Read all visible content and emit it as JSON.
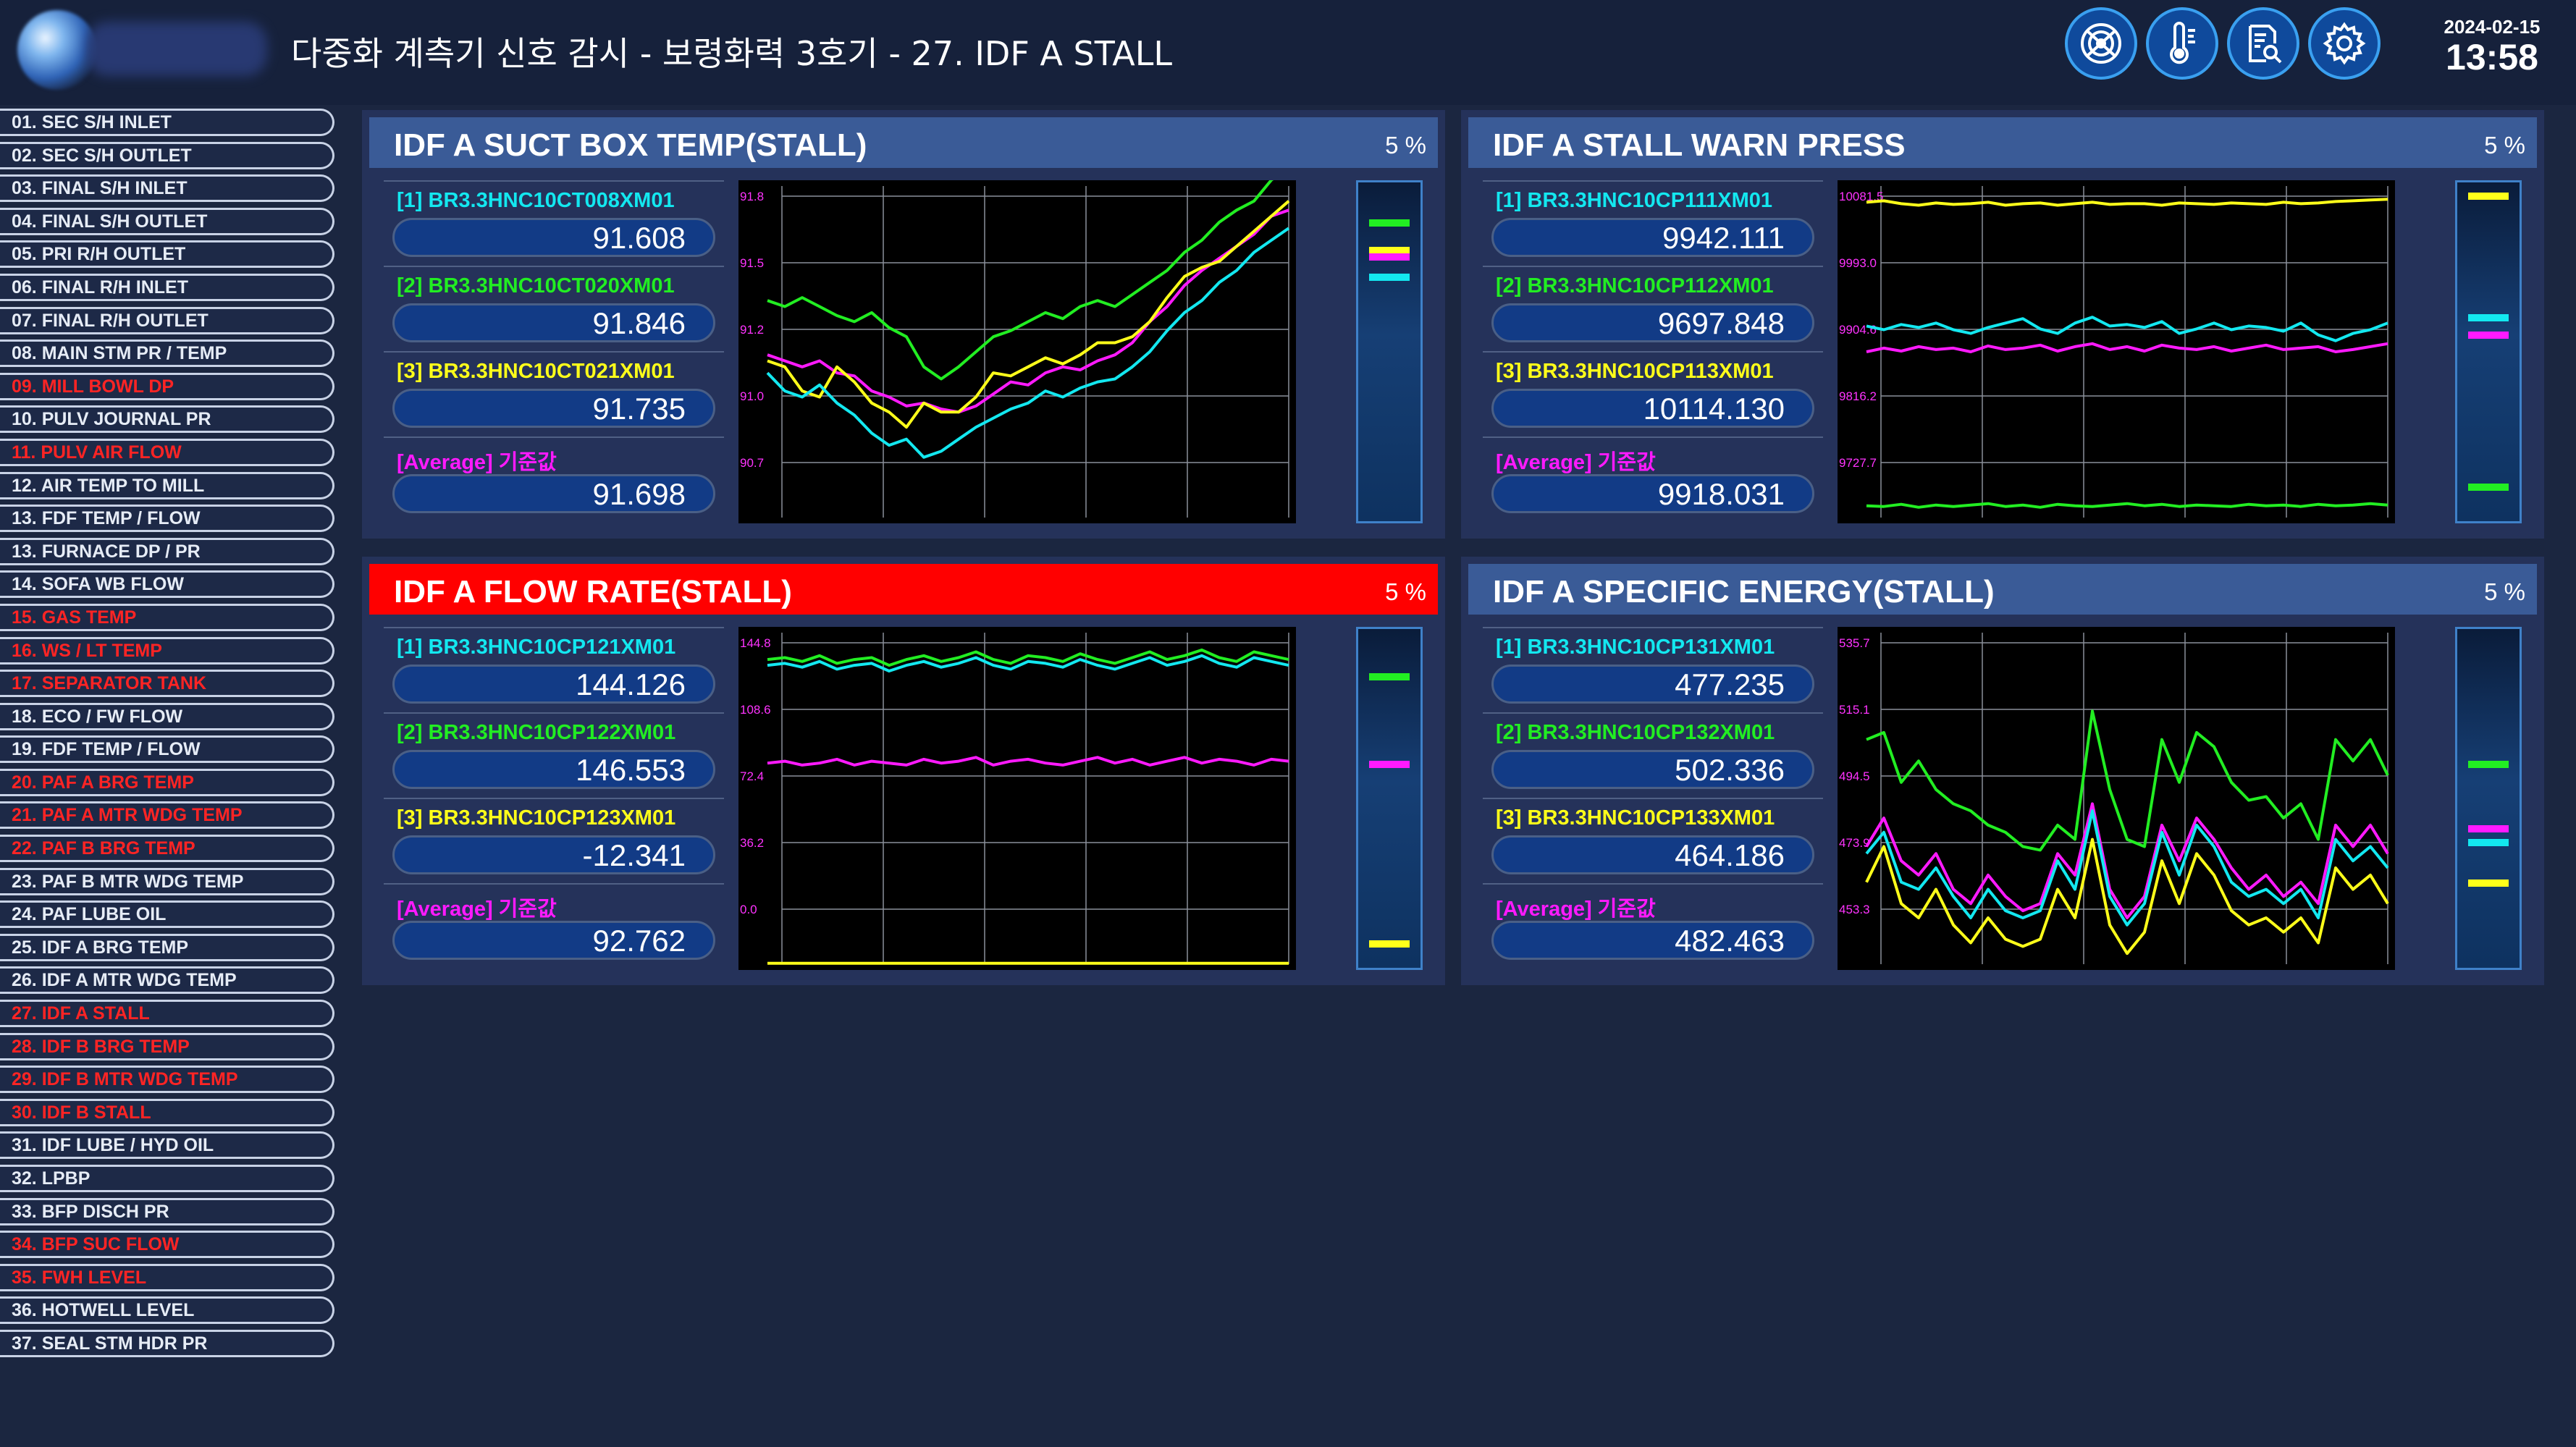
{
  "header": {
    "title": "다중화 계측기 신호 감시 - 보령화력 3호기 - 27. IDF A STALL",
    "date": "2024-02-15",
    "time": "13:58"
  },
  "toolbar_icons": [
    "radar-icon",
    "thermometer-icon",
    "report-search-icon",
    "gear-icon"
  ],
  "sidebar": {
    "items": [
      {
        "label": "01. SEC S/H INLET",
        "alert": false
      },
      {
        "label": "02. SEC S/H OUTLET",
        "alert": false
      },
      {
        "label": "03. FINAL S/H INLET",
        "alert": false
      },
      {
        "label": "04. FINAL S/H OUTLET",
        "alert": false
      },
      {
        "label": "05. PRI R/H OUTLET",
        "alert": false
      },
      {
        "label": "06. FINAL R/H INLET",
        "alert": false
      },
      {
        "label": "07. FINAL R/H OUTLET",
        "alert": false
      },
      {
        "label": "08. MAIN STM PR / TEMP",
        "alert": false
      },
      {
        "label": "09. MILL BOWL DP",
        "alert": true
      },
      {
        "label": "10. PULV JOURNAL PR",
        "alert": false
      },
      {
        "label": "11. PULV AIR FLOW",
        "alert": true
      },
      {
        "label": "12. AIR TEMP TO MILL",
        "alert": false
      },
      {
        "label": "13. FDF TEMP / FLOW",
        "alert": false
      },
      {
        "label": "13. FURNACE DP / PR",
        "alert": false
      },
      {
        "label": "14. SOFA WB FLOW",
        "alert": false
      },
      {
        "label": "15. GAS TEMP",
        "alert": true
      },
      {
        "label": "16. WS / LT TEMP",
        "alert": true
      },
      {
        "label": "17. SEPARATOR TANK",
        "alert": true
      },
      {
        "label": "18. ECO / FW FLOW",
        "alert": false
      },
      {
        "label": "19. FDF TEMP / FLOW",
        "alert": false
      },
      {
        "label": "20. PAF A BRG TEMP",
        "alert": true
      },
      {
        "label": "21. PAF A MTR WDG TEMP",
        "alert": true
      },
      {
        "label": "22. PAF B BRG TEMP",
        "alert": true
      },
      {
        "label": "23. PAF B MTR WDG TEMP",
        "alert": false
      },
      {
        "label": "24. PAF LUBE OIL",
        "alert": false
      },
      {
        "label": "25. IDF A BRG TEMP",
        "alert": false
      },
      {
        "label": "26. IDF A MTR WDG TEMP",
        "alert": false
      },
      {
        "label": "27. IDF A STALL",
        "alert": true
      },
      {
        "label": "28. IDF B BRG TEMP",
        "alert": true
      },
      {
        "label": "29. IDF B MTR WDG TEMP",
        "alert": true
      },
      {
        "label": "30. IDF B STALL",
        "alert": true
      },
      {
        "label": "31. IDF LUBE / HYD OIL",
        "alert": false
      },
      {
        "label": "32. LPBP",
        "alert": false
      },
      {
        "label": "33. BFP DISCH PR",
        "alert": false
      },
      {
        "label": "34. BFP SUC FLOW",
        "alert": true
      },
      {
        "label": "35. FWH LEVEL",
        "alert": true
      },
      {
        "label": "36. HOTWELL LEVEL",
        "alert": false
      },
      {
        "label": "37. SEAL STM HDR PR",
        "alert": false
      }
    ]
  },
  "colors": {
    "s1": "#13e8f0",
    "s2": "#22ee22",
    "s3": "#ffff1a",
    "avg": "#ff1aff",
    "alarm": "#ff0000",
    "header": "#3a5b97",
    "axis": "#ff33ff"
  },
  "panels": [
    {
      "title": "IDF A SUCT BOX TEMP(STALL)",
      "percent": "5 %",
      "alarm": false,
      "tags": [
        {
          "label": "[1] BR3.3HNC10CT008XM01",
          "value": "91.608",
          "color": "#13e8f0"
        },
        {
          "label": "[2] BR3.3HNC10CT020XM01",
          "value": "91.846",
          "color": "#22ee22"
        },
        {
          "label": "[3] BR3.3HNC10CT021XM01",
          "value": "91.735",
          "color": "#ffff1a"
        },
        {
          "label": "[Average] 기준값",
          "value": "91.698",
          "color": "#ff1aff"
        }
      ],
      "chart_data": {
        "type": "line",
        "ylim": [
          90.7,
          91.8
        ],
        "ytick_labels": [
          "91.8",
          "91.5",
          "91.2",
          "91.0",
          "90.7"
        ],
        "series": [
          {
            "color": "#22ee22",
            "values": [
              91.42,
              91.4,
              91.43,
              91.4,
              91.37,
              91.35,
              91.38,
              91.33,
              91.3,
              91.2,
              91.16,
              91.2,
              91.25,
              91.3,
              91.32,
              91.35,
              91.38,
              91.36,
              91.4,
              91.42,
              91.4,
              91.44,
              91.48,
              91.52,
              91.58,
              91.62,
              91.68,
              91.72,
              91.75,
              91.82,
              91.86
            ]
          },
          {
            "color": "#ff1aff",
            "values": [
              91.24,
              91.22,
              91.2,
              91.22,
              91.18,
              91.17,
              91.12,
              91.1,
              91.07,
              91.08,
              91.06,
              91.05,
              91.07,
              91.11,
              91.15,
              91.14,
              91.18,
              91.2,
              91.19,
              91.22,
              91.24,
              91.28,
              91.35,
              91.4,
              91.47,
              91.52,
              91.56,
              91.6,
              91.64,
              91.7,
              91.72
            ]
          },
          {
            "color": "#ffff1a",
            "values": [
              91.22,
              91.2,
              91.12,
              91.1,
              91.2,
              91.15,
              91.08,
              91.05,
              91.0,
              91.08,
              91.05,
              91.05,
              91.1,
              91.18,
              91.17,
              91.2,
              91.23,
              91.21,
              91.24,
              91.28,
              91.28,
              91.3,
              91.35,
              91.43,
              91.5,
              91.53,
              91.55,
              91.6,
              91.65,
              91.7,
              91.75
            ]
          },
          {
            "color": "#13e8f0",
            "values": [
              91.18,
              91.12,
              91.1,
              91.14,
              91.08,
              91.04,
              90.98,
              90.94,
              90.96,
              90.9,
              90.92,
              90.96,
              91.0,
              91.03,
              91.06,
              91.08,
              91.12,
              91.1,
              91.13,
              91.15,
              91.16,
              91.2,
              91.25,
              91.32,
              91.38,
              91.42,
              91.48,
              91.52,
              91.58,
              91.62,
              91.66
            ]
          }
        ]
      },
      "gauge": {
        "levels": [
          0.88,
          0.8,
          0.78,
          0.72
        ],
        "colors": [
          "#22ee22",
          "#ffff1a",
          "#ff1aff",
          "#13e8f0"
        ]
      }
    },
    {
      "title": "IDF A STALL WARN PRESS",
      "percent": "5 %",
      "alarm": false,
      "tags": [
        {
          "label": "[1] BR3.3HNC10CP111XM01",
          "value": "9942.111",
          "color": "#13e8f0"
        },
        {
          "label": "[2] BR3.3HNC10CP112XM01",
          "value": "9697.848",
          "color": "#22ee22"
        },
        {
          "label": "[3] BR3.3HNC10CP113XM01",
          "value": "10114.130",
          "color": "#ffff1a"
        },
        {
          "label": "[Average] 기준값",
          "value": "9918.031",
          "color": "#ff1aff"
        }
      ],
      "chart_data": {
        "type": "line",
        "ylim": [
          9680,
          10130
        ],
        "ytick_labels": [
          "10081.5",
          "9993.0",
          "9904.6",
          "9816.2",
          "9727.7"
        ],
        "series": [
          {
            "color": "#ffff1a",
            "values": [
              10108,
              10110,
              10106,
              10104,
              10107,
              10105,
              10106,
              10108,
              10104,
              10106,
              10107,
              10104,
              10106,
              10108,
              10105,
              10106,
              10106,
              10104,
              10107,
              10106,
              10105,
              10107,
              10106,
              10105,
              10108,
              10106,
              10107,
              10109,
              10110,
              10111,
              10112
            ]
          },
          {
            "color": "#13e8f0",
            "values": [
              9940,
              9935,
              9942,
              9938,
              9944,
              9935,
              9930,
              9938,
              9944,
              9950,
              9936,
              9930,
              9944,
              9952,
              9940,
              9942,
              9938,
              9946,
              9930,
              9936,
              9944,
              9935,
              9940,
              9938,
              9933,
              9944,
              9928,
              9920,
              9930,
              9935,
              9944
            ]
          },
          {
            "color": "#ff1aff",
            "values": [
              9905,
              9910,
              9906,
              9912,
              9908,
              9910,
              9905,
              9913,
              9908,
              9910,
              9914,
              9906,
              9912,
              9916,
              9908,
              9912,
              9906,
              9914,
              9910,
              9908,
              9912,
              9906,
              9910,
              9914,
              9908,
              9910,
              9912,
              9905,
              9908,
              9912,
              9916
            ]
          },
          {
            "color": "#22ee22",
            "values": [
              9696,
              9695,
              9698,
              9694,
              9697,
              9695,
              9697,
              9699,
              9695,
              9697,
              9694,
              9698,
              9696,
              9695,
              9697,
              9699,
              9696,
              9698,
              9695,
              9697,
              9696,
              9695,
              9698,
              9696,
              9697,
              9695,
              9698,
              9696,
              9697,
              9699,
              9697
            ]
          }
        ]
      },
      "gauge": {
        "levels": [
          0.96,
          0.6,
          0.55,
          0.1
        ],
        "colors": [
          "#ffff1a",
          "#13e8f0",
          "#ff1aff",
          "#22ee22"
        ]
      }
    },
    {
      "title": "IDF A FLOW RATE(STALL)",
      "percent": "5 %",
      "alarm": true,
      "tags": [
        {
          "label": "[1] BR3.3HNC10CP121XM01",
          "value": "144.126",
          "color": "#13e8f0"
        },
        {
          "label": "[2] BR3.3HNC10CP122XM01",
          "value": "146.553",
          "color": "#22ee22"
        },
        {
          "label": "[3] BR3.3HNC10CP123XM01",
          "value": "-12.341",
          "color": "#ffff1a"
        },
        {
          "label": "[Average] 기준값",
          "value": "92.762",
          "color": "#ff1aff"
        }
      ],
      "chart_data": {
        "type": "line",
        "ylim": [
          -12.8,
          160
        ],
        "ytick_labels": [
          "144.8",
          "108.6",
          "72.4",
          "36.2",
          "0.0"
        ],
        "series": [
          {
            "color": "#22ee22",
            "values": [
              146,
              147,
              145,
              148,
              144,
              146,
              147,
              143,
              146,
              148,
              145,
              147,
              150,
              146,
              144,
              148,
              147,
              145,
              149,
              146,
              144,
              147,
              150,
              146,
              148,
              151,
              147,
              145,
              150,
              148,
              146
            ]
          },
          {
            "color": "#13e8f0",
            "values": [
              143,
              144,
              142,
              145,
              141,
              143,
              144,
              140,
              143,
              145,
              142,
              144,
              147,
              143,
              141,
              145,
              144,
              142,
              146,
              143,
              141,
              144,
              147,
              143,
              145,
              148,
              144,
              142,
              147,
              145,
              143
            ]
          },
          {
            "color": "#ff1aff",
            "values": [
              92,
              93,
              91,
              92,
              94,
              91,
              93,
              92,
              91,
              94,
              92,
              93,
              95,
              91,
              93,
              94,
              92,
              91,
              93,
              95,
              92,
              94,
              91,
              93,
              95,
              92,
              94,
              93,
              91,
              94,
              93
            ]
          },
          {
            "color": "#ffff1a",
            "values": [
              -12.3,
              -12.3,
              -12.3,
              -12.3,
              -12.3,
              -12.3,
              -12.3,
              -12.3,
              -12.3,
              -12.3,
              -12.3,
              -12.3,
              -12.3,
              -12.3,
              -12.3,
              -12.3,
              -12.3,
              -12.3,
              -12.3,
              -12.3,
              -12.3,
              -12.3,
              -12.3,
              -12.3,
              -12.3,
              -12.3,
              -12.3,
              -12.3,
              -12.3,
              -12.3,
              -12.3
            ]
          }
        ]
      },
      "gauge": {
        "levels": [
          0.86,
          0.6,
          0.07
        ],
        "colors": [
          "#22ee22",
          "#ff1aff",
          "#ffff1a"
        ]
      }
    },
    {
      "title": "IDF A SPECIFIC ENERGY(STALL)",
      "percent": "5 %",
      "alarm": false,
      "tags": [
        {
          "label": "[1] BR3.3HNC10CP131XM01",
          "value": "477.235",
          "color": "#13e8f0"
        },
        {
          "label": "[2] BR3.3HNC10CP132XM01",
          "value": "502.336",
          "color": "#22ee22"
        },
        {
          "label": "[3] BR3.3HNC10CP133XM01",
          "value": "464.186",
          "color": "#ffff1a"
        },
        {
          "label": "[Average] 기준값",
          "value": "482.463",
          "color": "#ff1aff"
        }
      ],
      "chart_data": {
        "type": "line",
        "ylim": [
          449,
          542
        ],
        "ytick_labels": [
          "535.7",
          "515.1",
          "494.5",
          "473.9",
          "453.3"
        ],
        "series": [
          {
            "color": "#22ee22",
            "values": [
              512,
              514,
              500,
              506,
              498,
              494,
              492,
              488,
              486,
              482,
              481,
              488,
              484,
              520,
              498,
              484,
              482,
              512,
              500,
              514,
              510,
              500,
              495,
              496,
              490,
              494,
              484,
              512,
              506,
              512,
              502
            ]
          },
          {
            "color": "#ff1aff",
            "values": [
              482,
              490,
              478,
              474,
              480,
              470,
              466,
              474,
              468,
              464,
              466,
              480,
              474,
              494,
              470,
              462,
              468,
              488,
              478,
              490,
              484,
              476,
              470,
              474,
              468,
              472,
              466,
              488,
              482,
              488,
              480
            ]
          },
          {
            "color": "#13e8f0",
            "values": [
              480,
              486,
              472,
              470,
              476,
              468,
              462,
              470,
              464,
              462,
              464,
              478,
              470,
              492,
              468,
              460,
              466,
              486,
              474,
              488,
              482,
              472,
              468,
              470,
              466,
              470,
              462,
              484,
              478,
              482,
              476
            ]
          },
          {
            "color": "#ffff1a",
            "values": [
              472,
              482,
              466,
              462,
              470,
              460,
              455,
              462,
              456,
              454,
              456,
              470,
              462,
              484,
              460,
              452,
              458,
              478,
              466,
              480,
              474,
              464,
              460,
              462,
              458,
              462,
              455,
              476,
              470,
              474,
              466
            ]
          }
        ]
      },
      "gauge": {
        "levels": [
          0.6,
          0.41,
          0.37,
          0.25
        ],
        "colors": [
          "#22ee22",
          "#ff1aff",
          "#13e8f0",
          "#ffff1a"
        ]
      }
    }
  ]
}
